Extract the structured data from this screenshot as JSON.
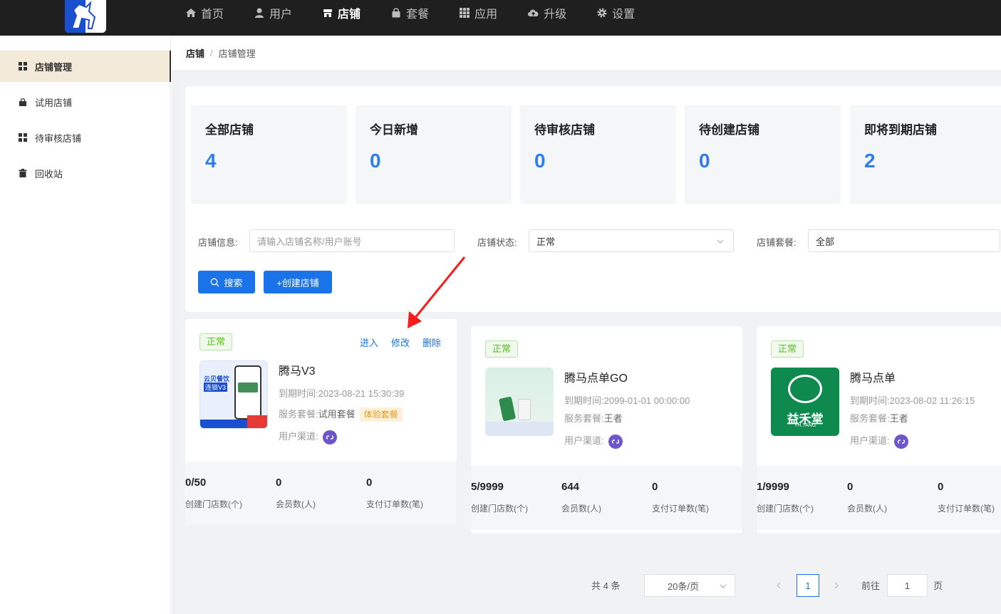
{
  "header": {
    "nav": [
      {
        "label": "首页",
        "icon": "home-icon"
      },
      {
        "label": "用户",
        "icon": "user-icon"
      },
      {
        "label": "店铺",
        "icon": "store-icon",
        "active": true
      },
      {
        "label": "套餐",
        "icon": "bag-icon"
      },
      {
        "label": "应用",
        "icon": "apps-grid-icon"
      },
      {
        "label": "升级",
        "icon": "cloud-upload-icon"
      },
      {
        "label": "设置",
        "icon": "gear-icon"
      }
    ]
  },
  "sidebar": {
    "items": [
      {
        "label": "店铺管理",
        "icon": "grid-icon",
        "active": true
      },
      {
        "label": "试用店铺",
        "icon": "lock-bag-icon"
      },
      {
        "label": "待审核店铺",
        "icon": "grid-icon"
      },
      {
        "label": "回收站",
        "icon": "trash-icon"
      }
    ]
  },
  "breadcrumb": {
    "root": "店铺",
    "separator": "/",
    "current": "店铺管理"
  },
  "stats": [
    {
      "label": "全部店铺",
      "value": "4"
    },
    {
      "label": "今日新增",
      "value": "0"
    },
    {
      "label": "待审核店铺",
      "value": "0"
    },
    {
      "label": "待创建店铺",
      "value": "0"
    },
    {
      "label": "即将到期店铺",
      "value": "2"
    }
  ],
  "filters": {
    "info_label": "店铺信息:",
    "info_placeholder": "请输入店铺名称/用户账号",
    "status_label": "店铺状态:",
    "status_value": "正常",
    "package_label": "店铺套餐:",
    "package_value": "全部",
    "search_button": "搜索",
    "create_button": "+创建店铺"
  },
  "stores": [
    {
      "status": "正常",
      "actions": [
        "进入",
        "修改",
        "删除"
      ],
      "name": "腾马V3",
      "thumb_text": [
        "云贝餐饮",
        "连锁V3"
      ],
      "expire_label": "到期时间:",
      "expire": "2023-08-21 15:30:39",
      "package_label": "服务套餐:",
      "package": "试用套餐",
      "package_tag": "体验套餐",
      "channel_label": "用户渠道:",
      "stats": [
        {
          "value": "0/50",
          "label": "创建门店数(个)"
        },
        {
          "value": "0",
          "label": "会员数(人)"
        },
        {
          "value": "0",
          "label": "支付订单数(笔)"
        }
      ]
    },
    {
      "status": "正常",
      "name": "腾马点单GO",
      "expire_label": "到期时间:",
      "expire": "2099-01-01 00:00:00",
      "package_label": "服务套餐:",
      "package": "王者",
      "channel_label": "用户渠道:",
      "stats": [
        {
          "value": "5/9999",
          "label": "创建门店数(个)"
        },
        {
          "value": "644",
          "label": "会员数(人)"
        },
        {
          "value": "0",
          "label": "支付订单数(笔)"
        }
      ]
    },
    {
      "status": "正常",
      "name": "腾马点单",
      "thumb_text": [
        "益禾堂",
        "YH.TANG"
      ],
      "expire_label": "到期时间:",
      "expire": "2023-08-02 11:26:15",
      "package_label": "服务套餐:",
      "package": "王者",
      "channel_label": "用户渠道:",
      "stats": [
        {
          "value": "1/9999",
          "label": "创建门店数(个)"
        },
        {
          "value": "0",
          "label": "会员数(人)"
        },
        {
          "value": "0",
          "label": "支付订单数(笔)"
        }
      ]
    }
  ],
  "pagination": {
    "total": "共 4 条",
    "page_size": "20条/页",
    "current_page": "1",
    "goto_label": "前往",
    "goto_value": "1",
    "goto_suffix": "页"
  },
  "colors": {
    "accent": "#1a73e8",
    "stat_value": "#2f7ef0",
    "status_green": "#52c41a",
    "sidebar_active": "#f4ead9",
    "annotation_arrow": "#ff1a1a"
  }
}
